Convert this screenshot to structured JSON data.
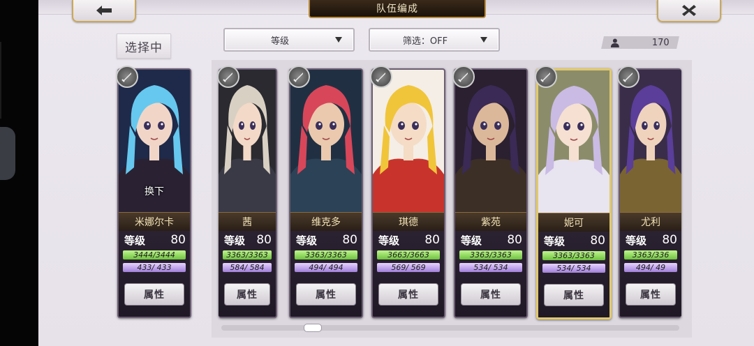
{
  "header": {
    "title": "队伍编成"
  },
  "tabs": {
    "selected_label": "选择中"
  },
  "filters": {
    "sort_label": "等级",
    "filter_label": "筛选：OFF"
  },
  "team_count": "170",
  "swap_label": "换下",
  "level_label": "等级",
  "attr_label": "属性",
  "colors": {
    "hp": "#7ccf46",
    "mp": "#b08ee3",
    "gold": "#c9a85a",
    "selected": "#e2c96a"
  },
  "cards": [
    {
      "name": "米娜尔卡",
      "level": "80",
      "hp": "3444/3444",
      "mp": "433/ 433",
      "hair": "#66c8ee",
      "bg": "#1f2a4a",
      "outfit": "#2a2233",
      "skin": "#f1d6c8"
    },
    {
      "name": "茜",
      "level": "80",
      "hp": "3363/3363",
      "mp": "584/ 584",
      "hair": "#d9d0c4",
      "bg": "#2a2a30",
      "outfit": "#3a3a46",
      "skin": "#f3d9c7"
    },
    {
      "name": "维克多",
      "level": "80",
      "hp": "3363/3363",
      "mp": "494/ 494",
      "hair": "#d8465a",
      "bg": "#203042",
      "outfit": "#2c4256",
      "skin": "#eac9ae"
    },
    {
      "name": "琪德",
      "level": "80",
      "hp": "3663/3663",
      "mp": "569/ 569",
      "hair": "#f1c53a",
      "bg": "#f4eee6",
      "outfit": "#c8342b",
      "skin": "#f5dcc6"
    },
    {
      "name": "紫苑",
      "level": "80",
      "hp": "3363/3363",
      "mp": "534/ 534",
      "hair": "#3a2a55",
      "bg": "#2a2030",
      "outfit": "#3c2f26",
      "skin": "#dcb89a"
    },
    {
      "name": "妮可",
      "level": "80",
      "hp": "3363/3363",
      "mp": "534/ 534",
      "hair": "#c9bbe4",
      "bg": "#8b8d6a",
      "outfit": "#e8e4f0",
      "skin": "#f5e0d2",
      "selected": true
    },
    {
      "name": "尤利",
      "level": "80",
      "hp": "3363/336",
      "mp": "494/ 49",
      "hair": "#5a3e9a",
      "bg": "#3a2d4a",
      "outfit": "#7a6432",
      "skin": "#f0d3bd"
    }
  ]
}
